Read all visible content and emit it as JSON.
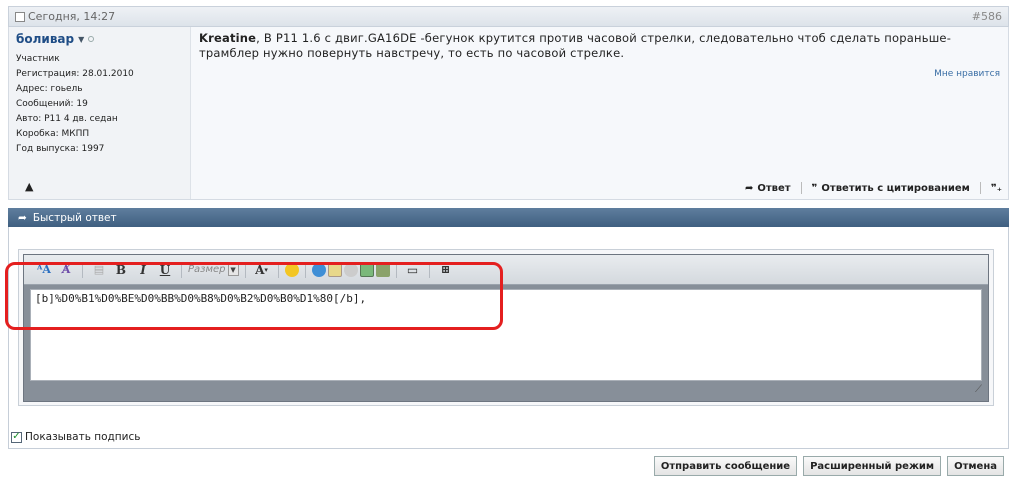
{
  "post": {
    "date": "Сегодня, 14:27",
    "number": "#586",
    "author": {
      "name": "боливар",
      "role": "Участник",
      "lines": [
        "Регистрация:   28.01.2010",
        "Адрес:         гоьель",
        "Сообщений:   19",
        "Авто: P11 4 дв. седан",
        "Коробка: МКПП",
        "Год выпуска: 1997"
      ]
    },
    "message_bold": "Kreatine",
    "message_text": ", В P11 1.6 с двиг.GA16DE -бегунок крутится против часовой стрелки, следовательно чтоб сделать пораньше- трамблер нужно повернуть навстречу, то есть по часовой стрелке.",
    "like_label": "Мне нравится",
    "reply_label": "Ответ",
    "quote_label": "Ответить с цитированием"
  },
  "quick_reply": {
    "title": "Быстрый ответ",
    "size_placeholder": "Размер",
    "editor_text": "[b]%D0%B1%D0%BE%D0%BB%D0%B8%D0%B2%D0%B0%D1%80[/b],",
    "signature_label": "Показывать подпись",
    "buttons": {
      "send": "Отправить сообщение",
      "advanced": "Расширенный режим",
      "cancel": "Отмена"
    }
  },
  "colors": {
    "highlight": "#e41f1f",
    "header_bar": "#4f6f90",
    "username": "#1f4d86"
  }
}
